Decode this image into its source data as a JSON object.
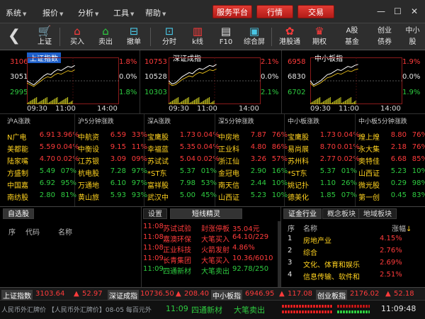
{
  "menubar": {
    "items": [
      "系统",
      "报价",
      "分析",
      "工具",
      "帮助"
    ],
    "buttons": [
      "服务平台",
      "行情",
      "交易"
    ]
  },
  "toolbar": {
    "tools": [
      "上证",
      "买入",
      "卖出",
      "撤单",
      "分时",
      "k线",
      "F10",
      "综合屏",
      "港股通",
      "期权",
      "A股",
      "创业",
      "中小"
    ],
    "tools_sub": [
      "",
      "",
      "",
      "",
      "",
      "",
      "",
      "",
      "",
      "",
      "基金",
      "债券",
      "股"
    ]
  },
  "indices": [
    {
      "title": "上证指数",
      "high": "3106",
      "mid": "3051",
      "low": "2995",
      "pct_high": "1.8%",
      "pct_mid": "0.0%",
      "pct_low": "1.8%",
      "time_start": "09:30",
      "time_mid": "11:00",
      "time_end": "14:00",
      "series": [
        0.0,
        -0.1,
        -0.2,
        -0.05,
        0.1,
        0.25,
        0.35,
        0.3,
        0.45,
        0.55,
        0.5,
        0.6,
        0.7,
        0.65,
        0.75
      ]
    },
    {
      "title": "深证成指",
      "high": "10753",
      "mid": "10528",
      "low": "10303",
      "pct_high": "2.1%",
      "pct_mid": "0.0%",
      "pct_low": "2.1%",
      "time_start": "09:30",
      "time_mid": "11:00",
      "time_end": "14:00",
      "series": [
        0.0,
        -0.15,
        -0.1,
        0.05,
        0.2,
        0.3,
        0.4,
        0.35,
        0.5,
        0.6,
        0.55,
        0.65,
        0.75,
        0.7,
        0.8
      ]
    },
    {
      "title": "中小板指",
      "high": "6958",
      "mid": "6830",
      "low": "6702",
      "pct_high": "1.9%",
      "pct_mid": "0.0%",
      "pct_low": "1.9%",
      "time_start": "09:30",
      "time_mid": "11:00",
      "time_end": "14:00",
      "series": [
        0.0,
        -0.2,
        -0.1,
        0.0,
        0.15,
        0.3,
        0.35,
        0.45,
        0.55,
        0.5,
        0.6,
        0.7,
        0.65,
        0.75,
        0.8
      ]
    }
  ],
  "quote_lists": [
    {
      "header": "沪A涨跌",
      "rows": [
        {
          "name": "N广电",
          "price": "6.91",
          "pct": "3.96%",
          "pc": "red"
        },
        {
          "name": "美都能",
          "price": "5.59",
          "pct": "0.04%",
          "pc": "red"
        },
        {
          "name": "陆家嘴",
          "price": "4.70",
          "pct": "0.02%",
          "pc": "red"
        },
        {
          "name": "方盛制",
          "price": "5.49",
          "pct": "07%",
          "pc": "green"
        },
        {
          "name": "中国嘉",
          "price": "6.92",
          "pct": "95%",
          "pc": "green"
        },
        {
          "name": "南纺股",
          "price": "2.80",
          "pct": "81%",
          "pc": "green"
        }
      ]
    },
    {
      "header": "沪5分钟涨跌",
      "rows": [
        {
          "name": "中航资",
          "price": "6.59",
          "pct": "33%",
          "pc": "red"
        },
        {
          "name": "中衡设",
          "price": "9.15",
          "pct": "11%",
          "pc": "red"
        },
        {
          "name": "江苏银",
          "price": "3.09",
          "pct": "09%",
          "pc": "red"
        },
        {
          "name": "杭电股",
          "price": "7.28",
          "pct": "97%",
          "pc": "green"
        },
        {
          "name": "万通地",
          "price": "6.10",
          "pct": "97%",
          "pc": "green"
        },
        {
          "name": "黄山旅",
          "price": "5.93",
          "pct": "93%",
          "pc": "green"
        }
      ]
    },
    {
      "header": "深A涨跌",
      "rows": [
        {
          "name": "宝鹰股",
          "price": "1.73",
          "pct": "0.04%",
          "pc": "red"
        },
        {
          "name": "幸福蓝",
          "price": "5.35",
          "pct": "0.04%",
          "pc": "red"
        },
        {
          "name": "苏试试",
          "price": "5.04",
          "pct": "0.02%",
          "pc": "red"
        },
        {
          "name": "*ST东",
          "price": "5.37",
          "pct": "01%",
          "pc": "green"
        },
        {
          "name": "富祥股",
          "price": "7.98",
          "pct": "53%",
          "pc": "green"
        },
        {
          "name": "武汉中",
          "price": "5.00",
          "pct": "45%",
          "pc": "green"
        }
      ]
    },
    {
      "header": "深5分钟涨跌",
      "rows": [
        {
          "name": "中房地",
          "price": "7.87",
          "pct": "76%",
          "pc": "red"
        },
        {
          "name": "正业科",
          "price": "4.80",
          "pct": "86%",
          "pc": "red"
        },
        {
          "name": "浙江仙",
          "price": "3.26",
          "pct": "57%",
          "pc": "red"
        },
        {
          "name": "金冠电",
          "price": "2.90",
          "pct": "16%",
          "pc": "green"
        },
        {
          "name": "南天信",
          "price": "2.44",
          "pct": "10%",
          "pc": "green"
        },
        {
          "name": "山西证",
          "price": "5.23",
          "pct": "10%",
          "pc": "green"
        }
      ]
    },
    {
      "header": "中小板涨跌",
      "rows": [
        {
          "name": "宝鹰股",
          "price": "1.73",
          "pct": "0.04%",
          "pc": "red"
        },
        {
          "name": "易尚展",
          "price": "8.70",
          "pct": "0.01%",
          "pc": "red"
        },
        {
          "name": "苏州科",
          "price": "2.77",
          "pct": "0.02%",
          "pc": "red"
        },
        {
          "name": "*ST东",
          "price": "5.37",
          "pct": "01%",
          "pc": "green"
        },
        {
          "name": "姚记扑",
          "price": "1.10",
          "pct": "26%",
          "pc": "green"
        },
        {
          "name": "德美化",
          "price": "1.85",
          "pct": "07%",
          "pc": "green"
        }
      ]
    },
    {
      "header": "中小板5分钟涨跌",
      "rows": [
        {
          "name": "煌上煌",
          "price": "8.80",
          "pct": "76%",
          "pc": "red"
        },
        {
          "name": "永大集",
          "price": "2.18",
          "pct": "76%",
          "pc": "red"
        },
        {
          "name": "奥特佳",
          "price": "6.68",
          "pct": "85%",
          "pc": "red"
        },
        {
          "name": "山西证",
          "price": "5.23",
          "pct": "10%",
          "pc": "green"
        },
        {
          "name": "微光股",
          "price": "0.29",
          "pct": "98%",
          "pc": "green"
        },
        {
          "name": "第一创",
          "price": "0.45",
          "pct": "83%",
          "pc": "green"
        }
      ]
    }
  ],
  "watchlist": {
    "tab": "自选股",
    "cols": [
      "序",
      "代码",
      "名称"
    ]
  },
  "news": {
    "tabs": [
      "设置",
      "短线精灵"
    ],
    "items": [
      {
        "time": "11:08",
        "stock": "苏试试验",
        "event": "封涨停板",
        "value": "35.04元",
        "color": "red"
      },
      {
        "time": "11:08",
        "stock": "嘉澳环保",
        "event": "大笔买入",
        "value": "64.10/229",
        "color": "red"
      },
      {
        "time": "11:08",
        "stock": "正业科技",
        "event": "火箭发射",
        "value": "4.86%",
        "color": "red"
      },
      {
        "time": "11:09",
        "stock": "长青集团",
        "event": "大笔买入",
        "value": "10.36/6010",
        "color": "red"
      },
      {
        "time": "11:09",
        "stock": "四通新材",
        "event": "大笔卖出",
        "value": "92.78/250",
        "color": "green"
      }
    ]
  },
  "sectors": {
    "tabs": [
      "证金行业",
      "概念板块",
      "地域板块"
    ],
    "cols": [
      "序",
      "名称",
      "涨幅"
    ],
    "rows": [
      {
        "idx": "1",
        "name": "房地产业",
        "pct": "4.15%"
      },
      {
        "idx": "2",
        "name": "综合",
        "pct": "2.76%"
      },
      {
        "idx": "3",
        "name": "文化、体育和娱乐",
        "pct": "2.69%"
      },
      {
        "idx": "4",
        "name": "信息传输、软件和",
        "pct": "2.51%"
      }
    ]
  },
  "statusbar": {
    "items": [
      {
        "label": "上证指数",
        "value": "3103.64",
        "change": "52.97"
      },
      {
        "label": "深证成指",
        "value": "10736.50",
        "change": "208.40"
      },
      {
        "label": "中小板指",
        "value": "6946.95",
        "change": "117.08"
      },
      {
        "label": "创业板指",
        "value": "2176.02",
        "change": "52.18"
      }
    ]
  },
  "ticker": {
    "left": "人民币外汇牌价 【人民币外汇牌价】08-05 每百元外",
    "time": "11:09",
    "stock": "四通新材",
    "event": "大笔卖出",
    "clock": "11:09:48"
  }
}
